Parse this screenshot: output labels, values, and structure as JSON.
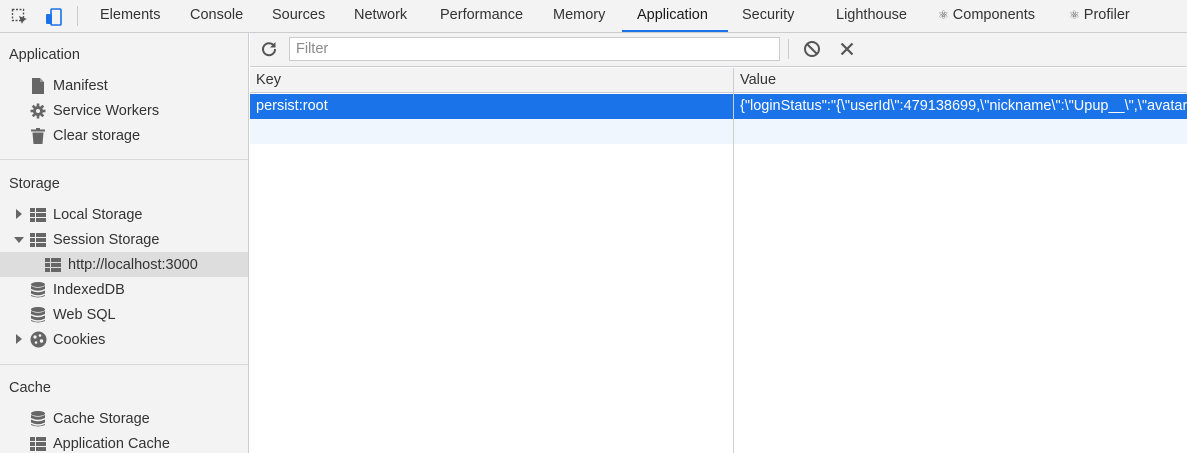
{
  "tabs": [
    "Elements",
    "Console",
    "Sources",
    "Network",
    "Performance",
    "Memory",
    "Application",
    "Security",
    "Lighthouse",
    "Components",
    "Profiler"
  ],
  "active_tab": "Application",
  "tab_icons": {
    "components": "react-icon",
    "profiler": "react-icon"
  },
  "sidebar": {
    "application": {
      "title": "Application",
      "items": [
        "Manifest",
        "Service Workers",
        "Clear storage"
      ]
    },
    "storage": {
      "title": "Storage",
      "items": [
        "Local Storage",
        "Session Storage",
        "http://localhost:3000",
        "IndexedDB",
        "Web SQL",
        "Cookies"
      ]
    },
    "cache": {
      "title": "Cache",
      "items": [
        "Cache Storage",
        "Application Cache"
      ]
    }
  },
  "toolbar": {
    "filter_placeholder": "Filter"
  },
  "table": {
    "columns": [
      "Key",
      "Value"
    ],
    "rows": [
      {
        "key": "persist:root",
        "value": "{\"loginStatus\":\"{\\\"userId\\\":479138699,\\\"nickname\\\":\\\"Upup__\\\",\\\"avatarUrl"
      }
    ]
  },
  "colors": {
    "accent": "#1a73e8",
    "selected_row": "#1a73e8",
    "sidebar_selected": "#dddddd"
  }
}
